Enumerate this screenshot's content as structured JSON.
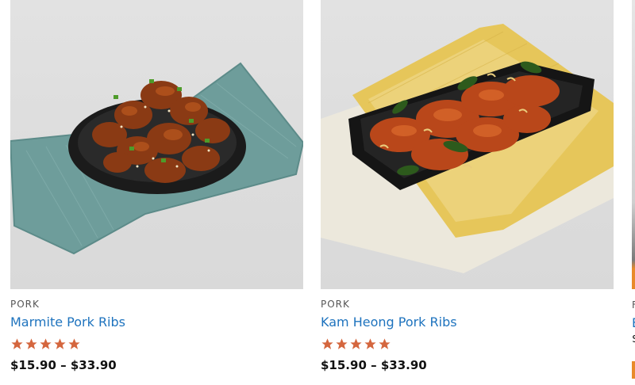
{
  "products": [
    {
      "category": "PORK",
      "title": "Marmite Pork Ribs",
      "rating": 5,
      "price": "$15.90 – $33.90"
    },
    {
      "category": "PORK",
      "title": "Kam Heong Pork Ribs",
      "rating": 5,
      "price": "$15.90 – $33.90"
    }
  ],
  "peek": {
    "category_letter": "F",
    "title_letter": "E",
    "price_letter": "$"
  },
  "colors": {
    "star": "#d4663e",
    "link": "#1e73be"
  }
}
